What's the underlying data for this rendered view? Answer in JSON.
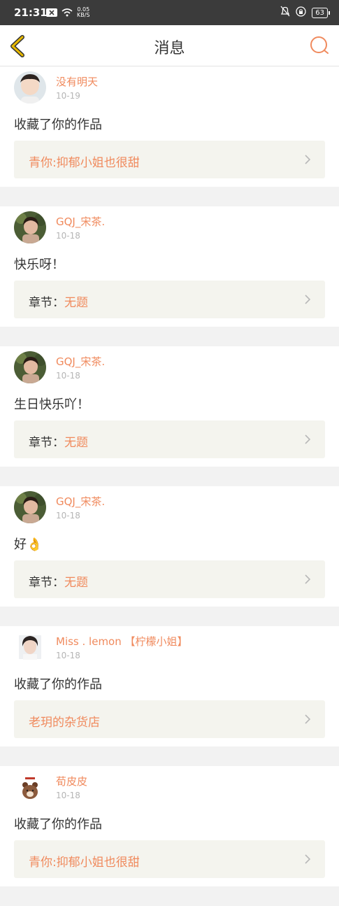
{
  "status_bar": {
    "time": "21:31",
    "speed_top": "0.05",
    "speed_bottom": "KB/S",
    "battery": "63"
  },
  "header": {
    "title": "消息"
  },
  "messages": [
    {
      "user": "没有明天",
      "date": "10-19",
      "text": "收藏了你的作品",
      "link_prefix": "",
      "link_value": "青你:抑郁小姐也很甜",
      "avatar": "boy"
    },
    {
      "user": "GQJ_宋茶.",
      "date": "10-18",
      "text": "快乐呀！",
      "link_prefix": "章节：",
      "link_value": "无题",
      "avatar": "girl-green"
    },
    {
      "user": "GQJ_宋茶.",
      "date": "10-18",
      "text": "生日快乐吖！",
      "link_prefix": "章节：",
      "link_value": "无题",
      "avatar": "girl-green"
    },
    {
      "user": "GQJ_宋茶.",
      "date": "10-18",
      "text": "好👌",
      "link_prefix": "章节：",
      "link_value": "无题",
      "avatar": "girl-green"
    },
    {
      "user": "Miss . lemon 【柠檬小姐】",
      "date": "10-18",
      "text": "收藏了你的作品",
      "link_prefix": "",
      "link_value": "老玥的杂货店",
      "avatar": "girl-white"
    },
    {
      "user": "荀皮皮",
      "date": "10-18",
      "text": "收藏了你的作品",
      "link_prefix": "",
      "link_value": "青你:抑郁小姐也很甜",
      "avatar": "bear"
    }
  ],
  "colors": {
    "accent": "#f08a5d",
    "back_icon": "#d9a400",
    "link_bg": "#f4f4ee"
  }
}
